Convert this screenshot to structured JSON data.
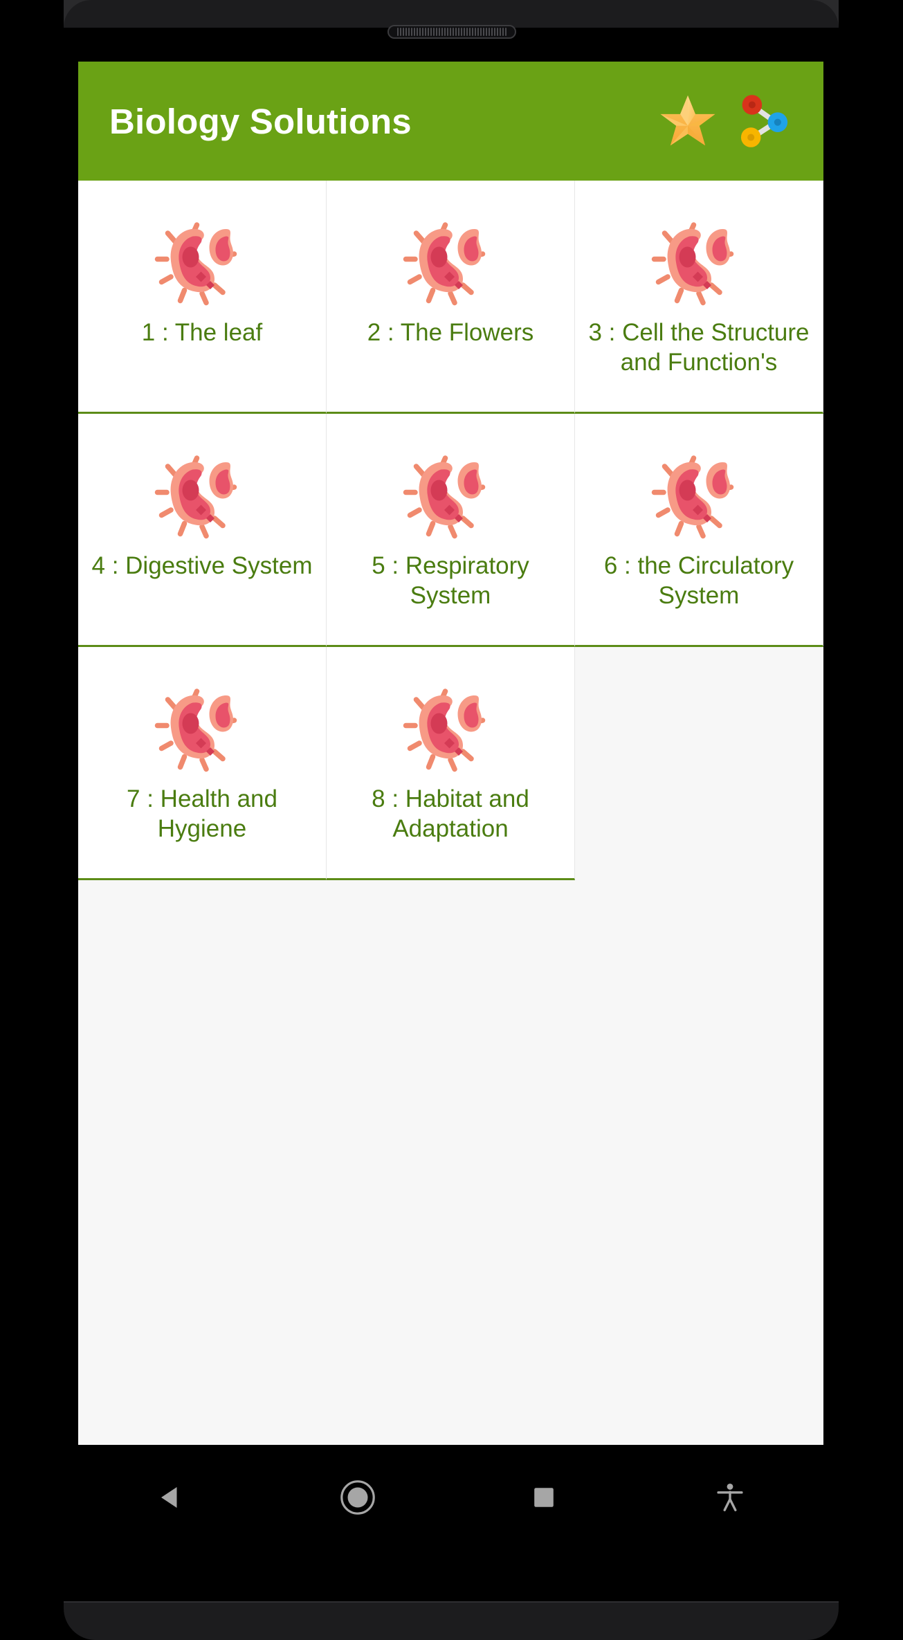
{
  "app": {
    "title": "Biology Solutions",
    "appbar_color": "#6AA215",
    "label_color": "#4a7c10",
    "card_bg": "#ffffff",
    "page_bg": "#f7f7f7"
  },
  "appbar": {
    "title": "Biology Solutions",
    "actions": [
      {
        "name": "favorites-star-icon",
        "label": "Favorites"
      },
      {
        "name": "molecule-share-icon",
        "label": "Share"
      }
    ]
  },
  "grid": {
    "item_icon_name": "bacteria-icon",
    "items": [
      {
        "label": "1 : The leaf"
      },
      {
        "label": "2 : The Flowers"
      },
      {
        "label": "3 : Cell the Structure and Function's"
      },
      {
        "label": "4 : Digestive System"
      },
      {
        "label": "5 : Respiratory System"
      },
      {
        "label": "6 : the Circulatory System"
      },
      {
        "label": "7 : Health and Hygiene"
      },
      {
        "label": "8 : Habitat and Adaptation"
      }
    ]
  },
  "navbar": {
    "buttons": [
      {
        "name": "nav-back-button",
        "label": "Back"
      },
      {
        "name": "nav-home-button",
        "label": "Home"
      },
      {
        "name": "nav-recents-button",
        "label": "Recents"
      },
      {
        "name": "nav-accessibility-button",
        "label": "Accessibility"
      }
    ]
  }
}
